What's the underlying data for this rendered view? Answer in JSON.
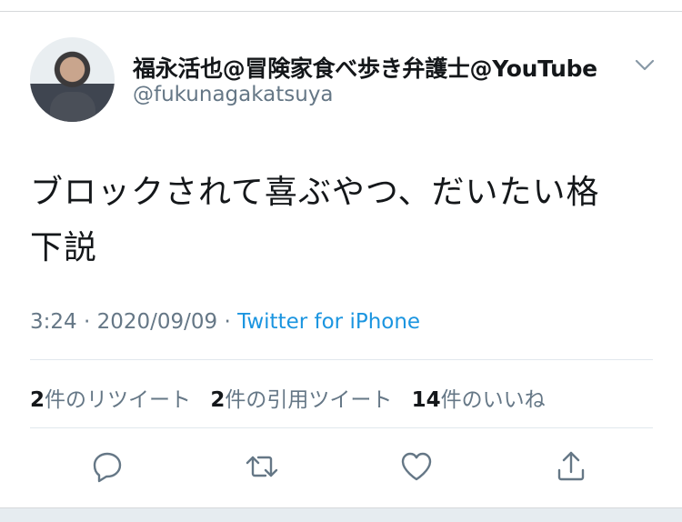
{
  "tweet": {
    "display_name": "福永活也@冒険家食べ歩き弁護士@YouTube",
    "handle": "@fukunagakatsuya",
    "text_line1": "ブロックされて喜ぶやつ、だいたい格",
    "text_line2": "下説",
    "time": "3:24",
    "date": "2020/09/09",
    "separator": "·",
    "source": "Twitter for iPhone",
    "stats": {
      "retweets_count": "2",
      "retweets_label": "件のリツイート",
      "quotes_count": "2",
      "quotes_label": "件の引用ツイート",
      "likes_count": "14",
      "likes_label": "件のいいね"
    }
  },
  "icons": {
    "more": "chevron-down-icon",
    "reply": "reply-icon",
    "retweet": "retweet-icon",
    "like": "heart-icon",
    "share": "share-icon"
  },
  "colors": {
    "link": "#1b95e0",
    "secondary_text": "#657786",
    "primary_text": "#14171a",
    "divider": "#e1e8ed"
  }
}
